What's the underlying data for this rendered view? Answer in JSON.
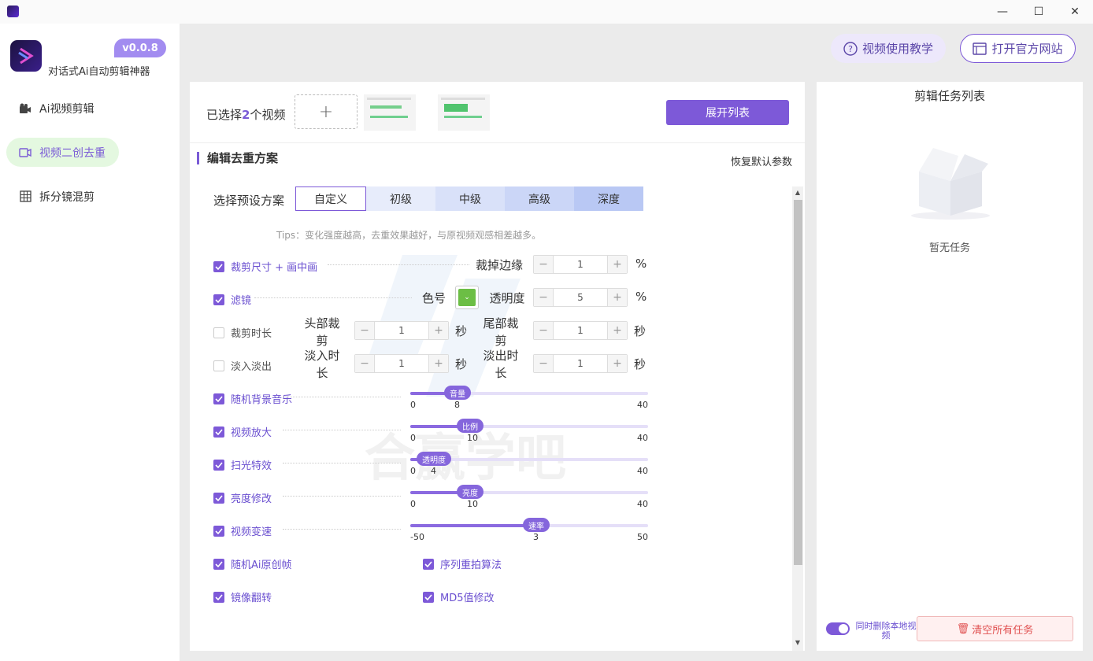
{
  "window": {
    "minimize_icon": "minimize-icon",
    "maximize_icon": "maximize-icon",
    "close_icon": "close-icon"
  },
  "app": {
    "version": "v0.0.8",
    "slogan": "对话式Ai自动剪辑神器"
  },
  "nav": [
    {
      "label": "Ai视频剪辑",
      "icon": "video-camera-icon"
    },
    {
      "label": "视频二创去重",
      "icon": "video-icon"
    },
    {
      "label": "拆分镜混剪",
      "icon": "grid-icon"
    }
  ],
  "header": {
    "tutorial": "视频使用教学",
    "website": "打开官方网站"
  },
  "select": {
    "prefix": "已选择",
    "count": "2",
    "suffix": "个视频",
    "add": "+",
    "expand": "展开列表"
  },
  "section": {
    "title": "编辑去重方案",
    "restore": "恢复默认参数"
  },
  "preset": {
    "label": "选择预设方案",
    "tabs": [
      "自定义",
      "初级",
      "中级",
      "高级",
      "深度"
    ],
    "selected": "自定义"
  },
  "tips": "Tips：变化强度越高，去重效果越好，与原视频观感相差越多。",
  "options": {
    "crop": {
      "label": "裁剪尺寸 + 画中画",
      "checked": true,
      "field": "裁掉边缘",
      "value": "1",
      "unit": "%"
    },
    "filter": {
      "label": "滤镜",
      "checked": true,
      "color_label": "色号",
      "color": "#6cbe45",
      "opacity_label": "透明度",
      "value": "5",
      "unit": "%"
    },
    "trim": {
      "label": "裁剪时长",
      "checked": false,
      "head_label": "头部裁剪",
      "head_value": "1",
      "head_unit": "秒",
      "tail_label": "尾部裁剪",
      "tail_value": "1",
      "tail_unit": "秒"
    },
    "fade": {
      "label": "淡入淡出",
      "checked": false,
      "in_label": "淡入时长",
      "in_value": "1",
      "in_unit": "秒",
      "out_label": "淡出时长",
      "out_value": "1",
      "out_unit": "秒"
    }
  },
  "sliders": [
    {
      "label": "随机背景音乐",
      "checked": true,
      "knob": "音量",
      "min": "0",
      "max": "40",
      "value": "8"
    },
    {
      "label": "视频放大",
      "checked": true,
      "knob": "比例",
      "min": "0",
      "max": "40",
      "value": "10"
    },
    {
      "label": "扫光特效",
      "checked": true,
      "knob": "透明度",
      "min": "0",
      "max": "40",
      "value": "4"
    },
    {
      "label": "亮度修改",
      "checked": true,
      "knob": "亮度",
      "min": "0",
      "max": "40",
      "value": "10"
    },
    {
      "label": "视频变速",
      "checked": true,
      "knob": "速率",
      "min": "-50",
      "max": "50",
      "value": "3"
    }
  ],
  "extras": [
    {
      "label": "随机Ai原创帧",
      "checked": true
    },
    {
      "label": "序列重拍算法",
      "checked": true
    },
    {
      "label": "镜像翻转",
      "checked": true
    },
    {
      "label": "MD5值修改",
      "checked": true
    }
  ],
  "watermark_text": "合赢学吧",
  "task_panel": {
    "title": "剪辑任务列表",
    "empty": "暂无任务",
    "toggle_label": "同时删除本地视频",
    "toggle_on": true,
    "clear": "清空所有任务"
  },
  "colors": {
    "accent": "#7d59d8",
    "active_nav_bg": "#e4f8e0",
    "danger": "#e05050"
  }
}
